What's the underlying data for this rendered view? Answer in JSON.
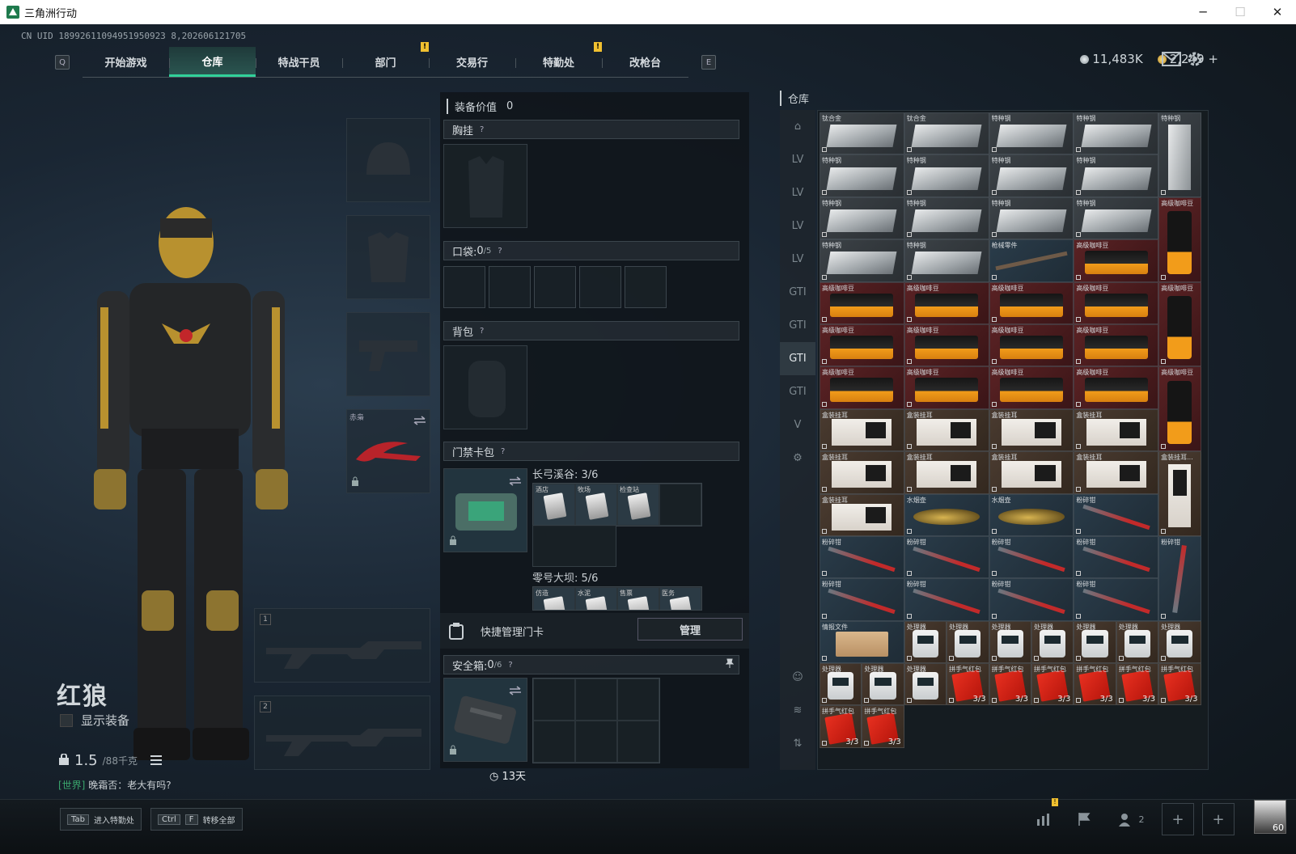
{
  "window": {
    "title": "三角洲行动",
    "minimize": "─",
    "maximize": "☐",
    "close": "✕"
  },
  "uid": "CN UID 18992611094951950923 8,202606121705",
  "nav": {
    "left_key": "Q",
    "right_key": "E",
    "alert_mark": "!",
    "tabs": [
      {
        "label": "开始游戏",
        "alert": false
      },
      {
        "label": "仓库",
        "alert": false,
        "active": true
      },
      {
        "label": "特战干员",
        "alert": false
      },
      {
        "label": "部门",
        "alert": true
      },
      {
        "label": "交易行",
        "alert": false
      },
      {
        "label": "特勤处",
        "alert": true
      },
      {
        "label": "改枪台",
        "alert": false
      }
    ]
  },
  "currency": {
    "silver": "11,483K",
    "gold": "2,249",
    "gold_add": "+"
  },
  "icons": {
    "mail": "mail-icon",
    "settings": "gear-icon"
  },
  "operator": {
    "name": "红狼",
    "show_equipment": "显示装备",
    "weight": "1.5",
    "weight_max": "/88千克",
    "chat_channel": "[世界]",
    "chat_text": "晚霜否：老大有吗?"
  },
  "slots": {
    "melee_label": "赤枭",
    "weapon1": "1",
    "weapon2": "2"
  },
  "loadout": {
    "equip_value_label": "装备价值",
    "equip_value": "0",
    "chest_rig": "胸挂",
    "pocket": "口袋:",
    "pocket_value": "0",
    "pocket_cap": "/5",
    "backpack": "背包",
    "card_case": "门禁卡包",
    "help": "?",
    "map1": {
      "title": "长弓溪谷: 3/6",
      "cards": [
        "酒店",
        "牧场",
        "检查站"
      ]
    },
    "map2": {
      "title": "零号大坝: 5/6",
      "cards": [
        "仿造",
        "水泥",
        "售票",
        "医务"
      ]
    },
    "quick_card": "快捷管理门卡",
    "manage": "管理",
    "safe_box": "安全箱:",
    "safe_value": "0",
    "safe_cap": "/6",
    "safe_timer": "13天"
  },
  "warehouse": {
    "title": "仓库",
    "side_icons": [
      "home-icon",
      "lv-icon",
      "lv-icon",
      "lv-icon",
      "lv-icon",
      "gti-icon",
      "gti-icon",
      "gti-icon",
      "gti-icon",
      "v-icon",
      "gear-icon"
    ],
    "side_bottom": [
      "operator-icon",
      "layers-icon",
      "sort-icon"
    ],
    "items": [
      {
        "r": 1,
        "c": 1,
        "w": 2,
        "h": 1,
        "name": "钛合金",
        "pic": "ingot",
        "bg": "gray"
      },
      {
        "r": 1,
        "c": 3,
        "w": 2,
        "h": 1,
        "name": "钛合金",
        "pic": "ingot",
        "bg": "gray"
      },
      {
        "r": 1,
        "c": 5,
        "w": 2,
        "h": 1,
        "name": "特种钢",
        "pic": "ingot",
        "bg": "gray"
      },
      {
        "r": 1,
        "c": 7,
        "w": 2,
        "h": 1,
        "name": "特种钢",
        "pic": "ingot",
        "bg": "gray"
      },
      {
        "r": 1,
        "c": 9,
        "w": 1,
        "h": 2,
        "name": "特种钢",
        "pic": "ingot-v",
        "bg": "gray"
      },
      {
        "r": 2,
        "c": 1,
        "w": 2,
        "h": 1,
        "name": "特种钢",
        "pic": "ingot",
        "bg": "gray"
      },
      {
        "r": 2,
        "c": 3,
        "w": 2,
        "h": 1,
        "name": "特种钢",
        "pic": "ingot",
        "bg": "gray"
      },
      {
        "r": 2,
        "c": 5,
        "w": 2,
        "h": 1,
        "name": "特种钢",
        "pic": "ingot",
        "bg": "gray"
      },
      {
        "r": 2,
        "c": 7,
        "w": 2,
        "h": 1,
        "name": "特种钢",
        "pic": "ingot",
        "bg": "gray"
      },
      {
        "r": 3,
        "c": 1,
        "w": 2,
        "h": 1,
        "name": "特种钢",
        "pic": "ingot",
        "bg": "gray"
      },
      {
        "r": 3,
        "c": 3,
        "w": 2,
        "h": 1,
        "name": "特种钢",
        "pic": "ingot",
        "bg": "gray"
      },
      {
        "r": 3,
        "c": 5,
        "w": 2,
        "h": 1,
        "name": "特种钢",
        "pic": "ingot",
        "bg": "gray"
      },
      {
        "r": 3,
        "c": 7,
        "w": 2,
        "h": 1,
        "name": "特种钢",
        "pic": "ingot",
        "bg": "gray"
      },
      {
        "r": 3,
        "c": 9,
        "w": 1,
        "h": 2,
        "name": "高级咖啡豆",
        "pic": "coffee-v",
        "bg": "red"
      },
      {
        "r": 4,
        "c": 1,
        "w": 2,
        "h": 1,
        "name": "特种钢",
        "pic": "ingot",
        "bg": "gray"
      },
      {
        "r": 4,
        "c": 3,
        "w": 2,
        "h": 1,
        "name": "特种钢",
        "pic": "ingot",
        "bg": "gray"
      },
      {
        "r": 4,
        "c": 5,
        "w": 2,
        "h": 1,
        "name": "枪械零件",
        "pic": "rifle",
        "bg": "blue"
      },
      {
        "r": 4,
        "c": 7,
        "w": 2,
        "h": 1,
        "name": "高级咖啡豆",
        "pic": "coffee",
        "bg": "red"
      },
      {
        "r": 5,
        "c": 1,
        "w": 2,
        "h": 1,
        "name": "高级咖啡豆",
        "pic": "coffee",
        "bg": "red"
      },
      {
        "r": 5,
        "c": 3,
        "w": 2,
        "h": 1,
        "name": "高级咖啡豆",
        "pic": "coffee",
        "bg": "red"
      },
      {
        "r": 5,
        "c": 5,
        "w": 2,
        "h": 1,
        "name": "高级咖啡豆",
        "pic": "coffee",
        "bg": "red"
      },
      {
        "r": 5,
        "c": 7,
        "w": 2,
        "h": 1,
        "name": "高级咖啡豆",
        "pic": "coffee",
        "bg": "red"
      },
      {
        "r": 5,
        "c": 9,
        "w": 1,
        "h": 2,
        "name": "高级咖啡豆",
        "pic": "coffee-v",
        "bg": "red"
      },
      {
        "r": 6,
        "c": 1,
        "w": 2,
        "h": 1,
        "name": "高级咖啡豆",
        "pic": "coffee",
        "bg": "red"
      },
      {
        "r": 6,
        "c": 3,
        "w": 2,
        "h": 1,
        "name": "高级咖啡豆",
        "pic": "coffee",
        "bg": "red"
      },
      {
        "r": 6,
        "c": 5,
        "w": 2,
        "h": 1,
        "name": "高级咖啡豆",
        "pic": "coffee",
        "bg": "red"
      },
      {
        "r": 6,
        "c": 7,
        "w": 2,
        "h": 1,
        "name": "高级咖啡豆",
        "pic": "coffee",
        "bg": "red"
      },
      {
        "r": 7,
        "c": 1,
        "w": 2,
        "h": 1,
        "name": "高级咖啡豆",
        "pic": "coffee",
        "bg": "red"
      },
      {
        "r": 7,
        "c": 3,
        "w": 2,
        "h": 1,
        "name": "高级咖啡豆",
        "pic": "coffee",
        "bg": "red"
      },
      {
        "r": 7,
        "c": 5,
        "w": 2,
        "h": 1,
        "name": "高级咖啡豆",
        "pic": "coffee",
        "bg": "red"
      },
      {
        "r": 7,
        "c": 7,
        "w": 2,
        "h": 1,
        "name": "高级咖啡豆",
        "pic": "coffee",
        "bg": "red"
      },
      {
        "r": 7,
        "c": 9,
        "w": 1,
        "h": 2,
        "name": "高级咖啡豆",
        "pic": "coffee-v",
        "bg": "red"
      },
      {
        "r": 8,
        "c": 1,
        "w": 2,
        "h": 1,
        "name": "盒装挂耳",
        "pic": "box",
        "bg": "brown"
      },
      {
        "r": 8,
        "c": 3,
        "w": 2,
        "h": 1,
        "name": "盒装挂耳",
        "pic": "box",
        "bg": "brown"
      },
      {
        "r": 8,
        "c": 5,
        "w": 2,
        "h": 1,
        "name": "盒装挂耳",
        "pic": "box",
        "bg": "brown"
      },
      {
        "r": 8,
        "c": 7,
        "w": 2,
        "h": 1,
        "name": "盒装挂耳",
        "pic": "box",
        "bg": "brown"
      },
      {
        "r": 9,
        "c": 1,
        "w": 2,
        "h": 1,
        "name": "盒装挂耳",
        "pic": "box",
        "bg": "brown"
      },
      {
        "r": 9,
        "c": 3,
        "w": 2,
        "h": 1,
        "name": "盒装挂耳",
        "pic": "box",
        "bg": "brown"
      },
      {
        "r": 9,
        "c": 5,
        "w": 2,
        "h": 1,
        "name": "盒装挂耳",
        "pic": "box",
        "bg": "brown"
      },
      {
        "r": 9,
        "c": 7,
        "w": 2,
        "h": 1,
        "name": "盒装挂耳",
        "pic": "box",
        "bg": "brown"
      },
      {
        "r": 9,
        "c": 9,
        "w": 1,
        "h": 2,
        "name": "盒装挂耳...",
        "pic": "box-v",
        "bg": "brown"
      },
      {
        "r": 10,
        "c": 1,
        "w": 2,
        "h": 1,
        "name": "盒装挂耳",
        "pic": "box",
        "bg": "brown"
      },
      {
        "r": 10,
        "c": 3,
        "w": 2,
        "h": 1,
        "name": "水烟壶",
        "pic": "hookah",
        "bg": "blue"
      },
      {
        "r": 10,
        "c": 5,
        "w": 2,
        "h": 1,
        "name": "水烟壶",
        "pic": "hookah",
        "bg": "blue"
      },
      {
        "r": 10,
        "c": 7,
        "w": 2,
        "h": 1,
        "name": "粉碎钳",
        "pic": "cutter",
        "bg": "blue"
      },
      {
        "r": 11,
        "c": 1,
        "w": 2,
        "h": 1,
        "name": "粉碎钳",
        "pic": "cutter",
        "bg": "blue"
      },
      {
        "r": 11,
        "c": 3,
        "w": 2,
        "h": 1,
        "name": "粉碎钳",
        "pic": "cutter",
        "bg": "blue"
      },
      {
        "r": 11,
        "c": 5,
        "w": 2,
        "h": 1,
        "name": "粉碎钳",
        "pic": "cutter",
        "bg": "blue"
      },
      {
        "r": 11,
        "c": 7,
        "w": 2,
        "h": 1,
        "name": "粉碎钳",
        "pic": "cutter",
        "bg": "blue"
      },
      {
        "r": 11,
        "c": 9,
        "w": 1,
        "h": 2,
        "name": "粉碎钳",
        "pic": "cutter-v",
        "bg": "blue"
      },
      {
        "r": 12,
        "c": 1,
        "w": 2,
        "h": 1,
        "name": "粉碎钳",
        "pic": "cutter",
        "bg": "blue"
      },
      {
        "r": 12,
        "c": 3,
        "w": 2,
        "h": 1,
        "name": "粉碎钳",
        "pic": "cutter",
        "bg": "blue"
      },
      {
        "r": 12,
        "c": 5,
        "w": 2,
        "h": 1,
        "name": "粉碎钳",
        "pic": "cutter",
        "bg": "blue"
      },
      {
        "r": 12,
        "c": 7,
        "w": 2,
        "h": 1,
        "name": "粉碎钳",
        "pic": "cutter",
        "bg": "blue"
      },
      {
        "r": 13,
        "c": 1,
        "w": 2,
        "h": 1,
        "name": "情报文件",
        "pic": "board",
        "bg": "blue"
      },
      {
        "r": 13,
        "c": 3,
        "w": 1,
        "h": 1,
        "name": "处理器",
        "pic": "device",
        "bg": "brown"
      },
      {
        "r": 13,
        "c": 4,
        "w": 1,
        "h": 1,
        "name": "处理器",
        "pic": "device",
        "bg": "brown"
      },
      {
        "r": 13,
        "c": 5,
        "w": 1,
        "h": 1,
        "name": "处理器",
        "pic": "device",
        "bg": "brown"
      },
      {
        "r": 13,
        "c": 6,
        "w": 1,
        "h": 1,
        "name": "处理器",
        "pic": "device",
        "bg": "brown"
      },
      {
        "r": 13,
        "c": 7,
        "w": 1,
        "h": 1,
        "name": "处理器",
        "pic": "device",
        "bg": "brown"
      },
      {
        "r": 13,
        "c": 8,
        "w": 1,
        "h": 1,
        "name": "处理器",
        "pic": "device",
        "bg": "brown"
      },
      {
        "r": 13,
        "c": 9,
        "w": 1,
        "h": 1,
        "name": "处理器",
        "pic": "device",
        "bg": "brown"
      },
      {
        "r": 14,
        "c": 1,
        "w": 1,
        "h": 1,
        "name": "处理器",
        "pic": "device",
        "bg": "brown"
      },
      {
        "r": 14,
        "c": 2,
        "w": 1,
        "h": 1,
        "name": "处理器",
        "pic": "device",
        "bg": "brown"
      },
      {
        "r": 14,
        "c": 3,
        "w": 1,
        "h": 1,
        "name": "处理器",
        "pic": "device",
        "bg": "brown"
      },
      {
        "r": 14,
        "c": 4,
        "w": 1,
        "h": 1,
        "name": "拼手气红包",
        "pic": "envelope",
        "bg": "brown",
        "count": "3/3"
      },
      {
        "r": 14,
        "c": 5,
        "w": 1,
        "h": 1,
        "name": "拼手气红包",
        "pic": "envelope",
        "bg": "brown",
        "count": "3/3"
      },
      {
        "r": 14,
        "c": 6,
        "w": 1,
        "h": 1,
        "name": "拼手气红包",
        "pic": "envelope",
        "bg": "brown",
        "count": "3/3"
      },
      {
        "r": 14,
        "c": 7,
        "w": 1,
        "h": 1,
        "name": "拼手气红包",
        "pic": "envelope",
        "bg": "brown",
        "count": "3/3"
      },
      {
        "r": 14,
        "c": 8,
        "w": 1,
        "h": 1,
        "name": "拼手气红包",
        "pic": "envelope",
        "bg": "brown",
        "count": "3/3"
      },
      {
        "r": 14,
        "c": 9,
        "w": 1,
        "h": 1,
        "name": "拼手气红包",
        "pic": "envelope",
        "bg": "brown",
        "count": "3/3"
      },
      {
        "r": 15,
        "c": 1,
        "w": 1,
        "h": 1,
        "name": "拼手气红包",
        "pic": "envelope",
        "bg": "brown",
        "count": "3/3"
      },
      {
        "r": 15,
        "c": 2,
        "w": 1,
        "h": 1,
        "name": "拼手气红包",
        "pic": "envelope",
        "bg": "brown",
        "count": "3/3"
      }
    ]
  },
  "bottom": {
    "tab_key": "Tab",
    "tab_label": "进入特勤处",
    "ctrl_key": "Ctrl",
    "f_key": "F",
    "transfer_label": "转移全部",
    "friends_count": "2",
    "plus": "+",
    "level": "60"
  }
}
